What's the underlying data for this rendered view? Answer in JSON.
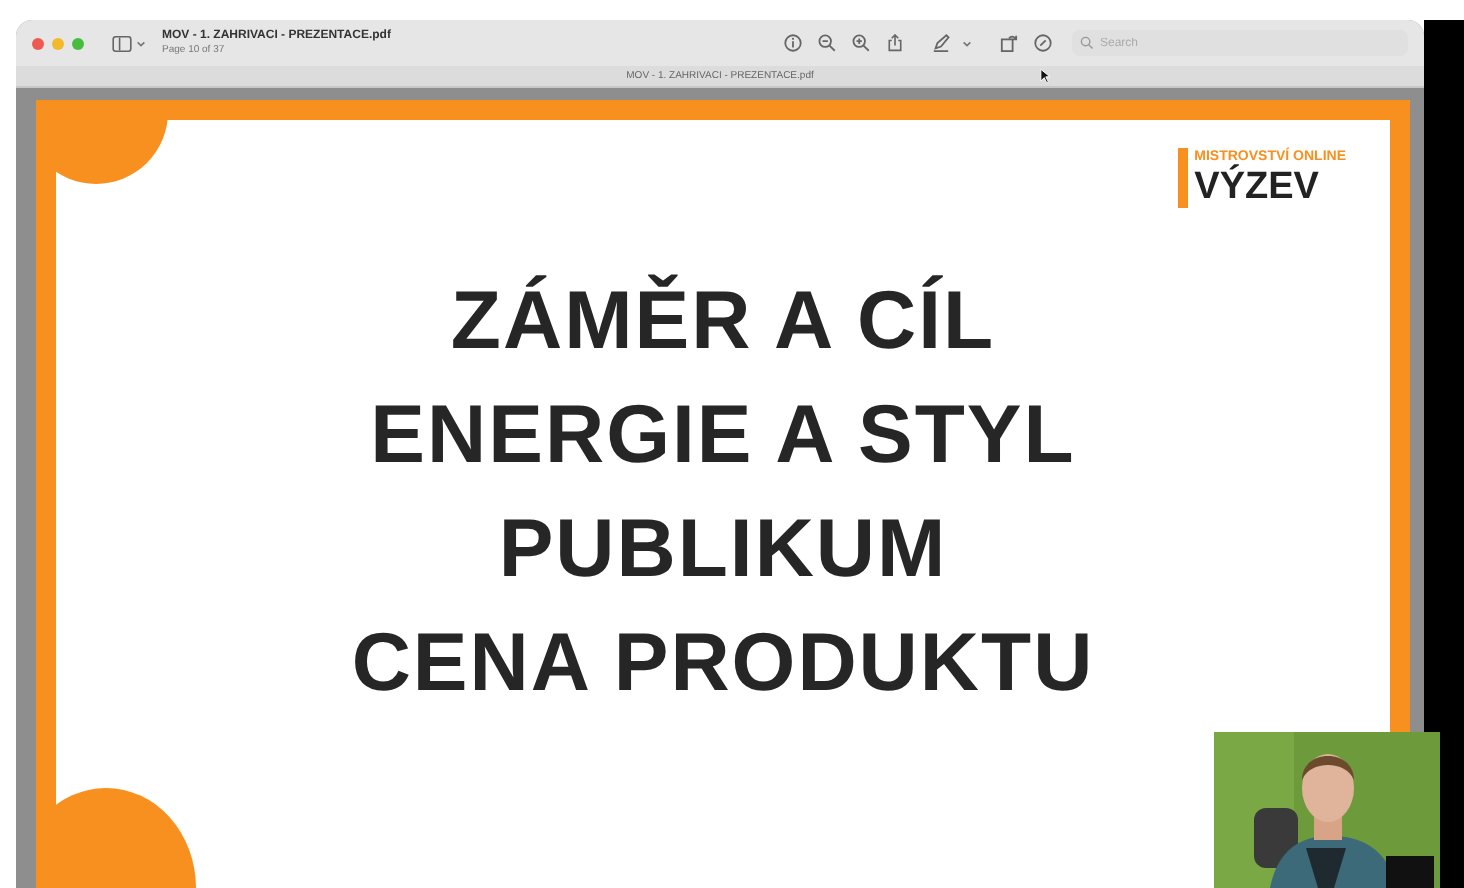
{
  "window": {
    "title": "MOV - 1. ZAHRIVACI - PREZENTACE.pdf",
    "subtitle": "Page 10 of 37"
  },
  "search": {
    "placeholder": "Search"
  },
  "tab": {
    "title": "MOV - 1. ZAHRIVACI - PREZENTACE.pdf"
  },
  "slide": {
    "brand_small": "MISTROVSTVÍ ONLINE",
    "brand_big": "VÝZEV",
    "lines": [
      "ZÁMĚR A CÍL",
      "ENERGIE A STYL",
      "PUBLIKUM",
      "CENA PRODUKTU"
    ]
  }
}
